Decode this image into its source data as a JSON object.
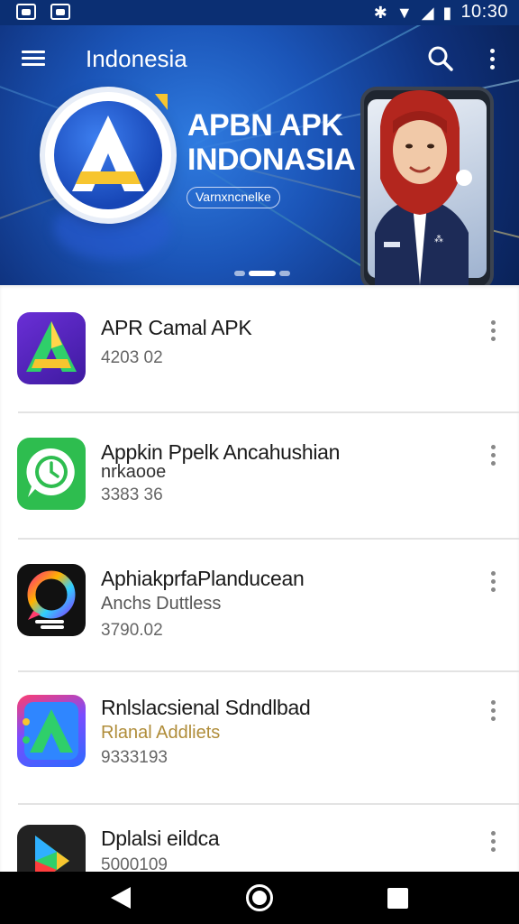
{
  "status_bar": {
    "time": "10:30",
    "wifi_icon": "wifi-icon",
    "signal_icon": "signal-icon",
    "battery_icon": "battery-icon"
  },
  "appbar": {
    "title": "Indonesia",
    "menu_icon": "hamburger-menu-icon",
    "search_icon": "search-icon",
    "overflow_icon": "more-vert-icon"
  },
  "banner": {
    "title_line1": "APBN APK",
    "title_line2": "INDONASIA",
    "pill_text": "Varnxncnelke",
    "logo_letter": "A",
    "carousel": {
      "active_index": 1,
      "count": 3
    }
  },
  "apps": [
    {
      "name": "APR Camal APK",
      "sub": "",
      "number": "4203 02",
      "icon": "apk-a-logo-icon"
    },
    {
      "name": "Appkin Ppelk Ancahushian",
      "sub": "nrkaooe",
      "number": "3383 36",
      "icon": "chat-clock-icon"
    },
    {
      "name": "AphiakprfaPlanducean",
      "sub": "Anchs Duttless",
      "number": "3790.02",
      "icon": "colorful-chat-icon"
    },
    {
      "name": "Rnlslacsienal Sdndlbad",
      "sub": "Rlanal Addliets",
      "number": "9333193",
      "icon": "green-a-logo-icon"
    },
    {
      "name": "Dplalsi eildca",
      "sub": "",
      "number": "5000109",
      "icon": "play-store-icon"
    }
  ],
  "colors": {
    "banner_dark": "#0a2258",
    "banner_light": "#2f7be0",
    "accent_yellow": "#f7c52f",
    "subtitle_gold": "#b08d3a"
  },
  "nav": {
    "back_icon": "back-triangle-icon",
    "home_icon": "home-circle-icon",
    "recent_icon": "recents-square-icon"
  }
}
